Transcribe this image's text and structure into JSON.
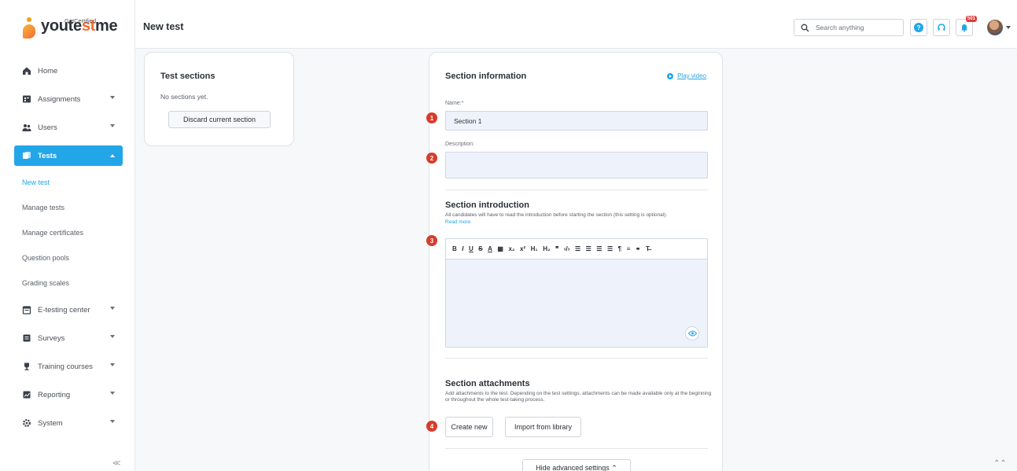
{
  "logo": {
    "brand_pre": "youte",
    "brand_hl": "st",
    "brand_post": "me",
    "sub": "GetCertified"
  },
  "sidebar": {
    "items": [
      {
        "label": "Home"
      },
      {
        "label": "Assignments"
      },
      {
        "label": "Users"
      },
      {
        "label": "Tests"
      }
    ],
    "sub_items": [
      {
        "label": "New test"
      },
      {
        "label": "Manage tests"
      },
      {
        "label": "Manage certificates"
      },
      {
        "label": "Question pools"
      },
      {
        "label": "Grading scales"
      }
    ],
    "items2": [
      {
        "label": "E-testing center"
      },
      {
        "label": "Surveys"
      },
      {
        "label": "Training courses"
      },
      {
        "label": "Reporting"
      },
      {
        "label": "System"
      }
    ],
    "collapse": "≪"
  },
  "header": {
    "title": "New test",
    "search_placeholder": "Search anything",
    "help": "?",
    "notif_count": "501"
  },
  "test_sections": {
    "title": "Test sections",
    "empty": "No sections yet.",
    "discard": "Discard current section"
  },
  "section_info": {
    "title": "Section information",
    "play_video": "Play video",
    "name_label": "Name:*",
    "name_value": "Section 1",
    "description_label": "Description:"
  },
  "section_intro": {
    "title": "Section introduction",
    "desc": "All candidates will have to read the introduction before starting the section (this setting is optional).",
    "read_more": "Read more",
    "toolbar": [
      "B",
      "I",
      "U",
      "S",
      "A",
      "▦",
      "x₂",
      "x²",
      "H₁",
      "H₂",
      "❞",
      "‹/›",
      "☰",
      "☰",
      "☰",
      "☰",
      "¶",
      "≡",
      "⚭",
      "T̶"
    ]
  },
  "section_attach": {
    "title": "Section attachments",
    "desc": "Add attachments to the test. Depending on the test settings, attachments can be made available only at the beginning or throughout the whole test-taking process.",
    "create_new": "Create new",
    "import": "Import from library"
  },
  "hide_advanced": "Hide advanced settings  ⌃",
  "markers": [
    "1",
    "2",
    "3",
    "4"
  ],
  "colors": {
    "accent": "#22a6e8",
    "marker": "#d83b2b",
    "logo_orange": "#f36b2c"
  }
}
